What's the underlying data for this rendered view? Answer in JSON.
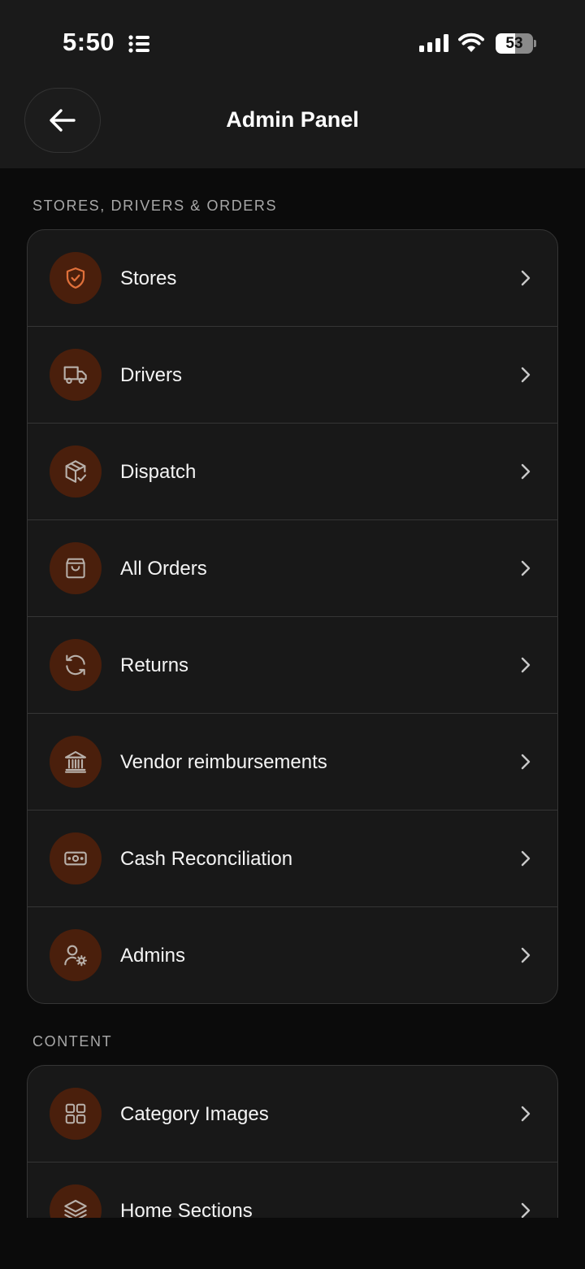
{
  "status_bar": {
    "time": "5:50",
    "battery": "53",
    "battery_level": 0.53
  },
  "header": {
    "title": "Admin Panel",
    "back_icon": "arrow-left-icon"
  },
  "sections": [
    {
      "label": "STORES, DRIVERS & ORDERS",
      "items": [
        {
          "label": "Stores",
          "icon": "shield-check-icon"
        },
        {
          "label": "Drivers",
          "icon": "truck-icon"
        },
        {
          "label": "Dispatch",
          "icon": "package-check-icon"
        },
        {
          "label": "All Orders",
          "icon": "shopping-bag-icon"
        },
        {
          "label": "Returns",
          "icon": "refresh-icon"
        },
        {
          "label": "Vendor reimbursements",
          "icon": "bank-icon"
        },
        {
          "label": "Cash Reconciliation",
          "icon": "banknote-icon"
        },
        {
          "label": "Admins",
          "icon": "user-cog-icon"
        }
      ]
    },
    {
      "label": "CONTENT",
      "items": [
        {
          "label": "Category Images",
          "icon": "grid-icon"
        },
        {
          "label": "Home Sections",
          "icon": "layers-icon"
        }
      ]
    }
  ],
  "colors": {
    "accent": "#e0703a",
    "icon_bg": "#4a1f0c",
    "card_bg": "#181818",
    "page_bg": "#0b0b0b",
    "header_bg": "#1a1a1a"
  }
}
